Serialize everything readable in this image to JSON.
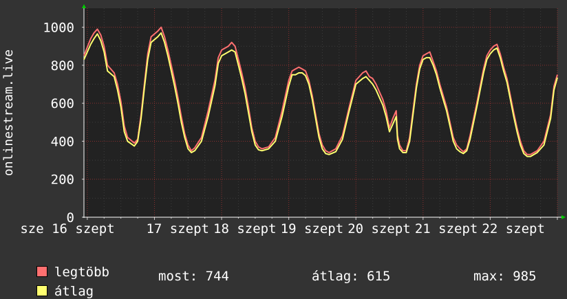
{
  "chart_data": {
    "type": "line",
    "ylabel": "onlinestream.live",
    "ylim": [
      0,
      1100
    ],
    "yticks": [
      0,
      200,
      400,
      600,
      800,
      1000
    ],
    "grid": true,
    "x_labels": [
      {
        "day": 16,
        "text": "sze 16 szept"
      },
      {
        "day": 17,
        "text": "17 szept"
      },
      {
        "day": 18,
        "text": "18 szept"
      },
      {
        "day": 19,
        "text": "19 szept"
      },
      {
        "day": 20,
        "text": "20 szept"
      },
      {
        "day": 21,
        "text": "21 szept"
      },
      {
        "day": 22,
        "text": "22 szept"
      }
    ],
    "x_range_days": [
      15.95,
      23.0
    ],
    "series": [
      {
        "name": "legtöbb",
        "color": "#ff7070"
      },
      {
        "name": "átlag",
        "color": "#ffff70"
      }
    ],
    "x": [
      15.95,
      16.05,
      16.1,
      16.15,
      16.2,
      16.25,
      16.3,
      16.4,
      16.45,
      16.5,
      16.55,
      16.6,
      16.7,
      16.75,
      16.8,
      16.85,
      16.9,
      16.95,
      17.05,
      17.1,
      17.15,
      17.2,
      17.25,
      17.3,
      17.35,
      17.4,
      17.45,
      17.5,
      17.55,
      17.6,
      17.7,
      17.8,
      17.9,
      17.95,
      18.0,
      18.1,
      18.15,
      18.2,
      18.25,
      18.3,
      18.35,
      18.4,
      18.45,
      18.5,
      18.55,
      18.6,
      18.7,
      18.8,
      18.9,
      19.0,
      19.05,
      19.1,
      19.15,
      19.2,
      19.25,
      19.3,
      19.35,
      19.4,
      19.45,
      19.5,
      19.55,
      19.6,
      19.7,
      19.8,
      19.9,
      20.0,
      20.05,
      20.1,
      20.15,
      20.2,
      20.25,
      20.3,
      20.35,
      20.4,
      20.45,
      20.5,
      20.55,
      20.6,
      20.62,
      20.65,
      20.7,
      20.75,
      20.8,
      20.85,
      20.9,
      20.95,
      21.0,
      21.05,
      21.1,
      21.15,
      21.2,
      21.25,
      21.3,
      21.35,
      21.4,
      21.45,
      21.5,
      21.55,
      21.6,
      21.65,
      21.7,
      21.8,
      21.9,
      21.95,
      22.0,
      22.05,
      22.1,
      22.15,
      22.2,
      22.25,
      22.3,
      22.35,
      22.4,
      22.45,
      22.5,
      22.55,
      22.6,
      22.7,
      22.8,
      22.9,
      22.95,
      23.0
    ],
    "values_max": [
      850,
      940,
      970,
      990,
      960,
      900,
      800,
      760,
      700,
      610,
      480,
      420,
      390,
      410,
      540,
      700,
      860,
      950,
      980,
      1000,
      950,
      880,
      800,
      720,
      630,
      530,
      440,
      380,
      350,
      365,
      420,
      560,
      720,
      840,
      880,
      900,
      920,
      900,
      830,
      760,
      680,
      580,
      470,
      400,
      370,
      360,
      370,
      420,
      560,
      720,
      770,
      780,
      790,
      780,
      770,
      720,
      640,
      540,
      440,
      380,
      350,
      340,
      360,
      430,
      580,
      720,
      740,
      760,
      770,
      740,
      730,
      700,
      660,
      620,
      560,
      470,
      520,
      560,
      430,
      380,
      350,
      350,
      420,
      560,
      700,
      800,
      850,
      860,
      870,
      820,
      770,
      700,
      640,
      580,
      500,
      420,
      380,
      360,
      345,
      360,
      430,
      600,
      780,
      850,
      880,
      900,
      910,
      860,
      790,
      730,
      640,
      550,
      470,
      400,
      350,
      330,
      330,
      350,
      400,
      540,
      690,
      750
    ],
    "values_avg": [
      830,
      910,
      940,
      965,
      930,
      870,
      770,
      740,
      670,
      580,
      450,
      400,
      375,
      400,
      520,
      680,
      830,
      920,
      950,
      970,
      920,
      850,
      770,
      690,
      600,
      500,
      420,
      360,
      340,
      350,
      400,
      530,
      690,
      810,
      850,
      870,
      880,
      870,
      800,
      730,
      650,
      550,
      450,
      380,
      355,
      350,
      360,
      400,
      530,
      690,
      750,
      750,
      760,
      760,
      745,
      700,
      620,
      520,
      420,
      360,
      335,
      330,
      345,
      410,
      560,
      700,
      715,
      730,
      740,
      720,
      700,
      670,
      630,
      590,
      530,
      450,
      490,
      530,
      410,
      360,
      340,
      340,
      400,
      540,
      680,
      780,
      830,
      840,
      840,
      800,
      750,
      680,
      620,
      560,
      480,
      400,
      360,
      345,
      335,
      350,
      410,
      580,
      760,
      830,
      860,
      880,
      890,
      840,
      770,
      710,
      620,
      530,
      450,
      380,
      335,
      320,
      320,
      340,
      380,
      520,
      670,
      735
    ],
    "legend": [
      {
        "name": "legtöbb",
        "color": "#ff7070"
      },
      {
        "name": "átlag",
        "color": "#ffff70"
      }
    ],
    "stats": {
      "most": "most: 744",
      "atlag": "átlag: 615",
      "max": "max: 985"
    }
  }
}
